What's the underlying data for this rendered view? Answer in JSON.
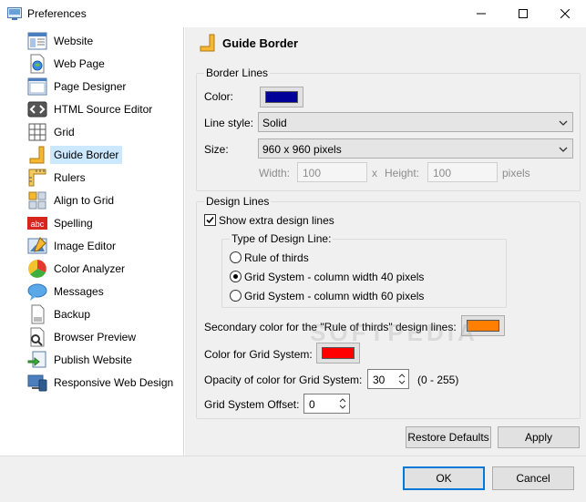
{
  "window": {
    "title": "Preferences"
  },
  "sidebar": {
    "items": [
      {
        "label": "Website",
        "icon": "website-icon"
      },
      {
        "label": "Web Page",
        "icon": "web-page-icon"
      },
      {
        "label": "Page Designer",
        "icon": "page-designer-icon"
      },
      {
        "label": "HTML Source Editor",
        "icon": "html-source-editor-icon"
      },
      {
        "label": "Grid",
        "icon": "grid-icon"
      },
      {
        "label": "Guide Border",
        "icon": "guide-border-icon",
        "selected": true
      },
      {
        "label": "Rulers",
        "icon": "rulers-icon"
      },
      {
        "label": "Align to Grid",
        "icon": "align-to-grid-icon"
      },
      {
        "label": "Spelling",
        "icon": "spelling-icon"
      },
      {
        "label": "Image Editor",
        "icon": "image-editor-icon"
      },
      {
        "label": "Color Analyzer",
        "icon": "color-analyzer-icon"
      },
      {
        "label": "Messages",
        "icon": "messages-icon"
      },
      {
        "label": "Backup",
        "icon": "backup-icon"
      },
      {
        "label": "Browser Preview",
        "icon": "browser-preview-icon"
      },
      {
        "label": "Publish Website",
        "icon": "publish-website-icon"
      },
      {
        "label": "Responsive Web Design",
        "icon": "responsive-web-design-icon"
      }
    ]
  },
  "page": {
    "title": "Guide Border"
  },
  "border_lines": {
    "legend": "Border Lines",
    "color_label": "Color:",
    "color_value": "#000099",
    "line_style_label": "Line style:",
    "line_style_value": "Solid",
    "size_label": "Size:",
    "size_value": "960 x 960 pixels",
    "width_label": "Width:",
    "width_value": "100",
    "x_sep": "x",
    "height_label": "Height:",
    "height_value": "100",
    "unit_label": "pixels"
  },
  "design_lines": {
    "legend": "Design Lines",
    "show_extra_label": "Show extra design lines",
    "show_extra_checked": true,
    "type_legend": "Type of Design Line:",
    "options": [
      {
        "label": "Rule of thirds",
        "selected": false
      },
      {
        "label": "Grid System - column width 40 pixels",
        "selected": true
      },
      {
        "label": "Grid System - column width 60 pixels",
        "selected": false
      }
    ],
    "secondary_color_label": "Secondary color for the \"Rule of thirds\" design lines:",
    "secondary_color_value": "#ff8000",
    "grid_color_label": "Color for Grid System:",
    "grid_color_value": "#ff0000",
    "opacity_label": "Opacity of color for Grid System:",
    "opacity_value": "30",
    "opacity_range": "(0 - 255)",
    "offset_label": "Grid System Offset:",
    "offset_value": "0"
  },
  "buttons": {
    "restore_defaults": "Restore Defaults",
    "apply": "Apply",
    "ok": "OK",
    "cancel": "Cancel"
  },
  "watermark": "SOFTPEDIA"
}
